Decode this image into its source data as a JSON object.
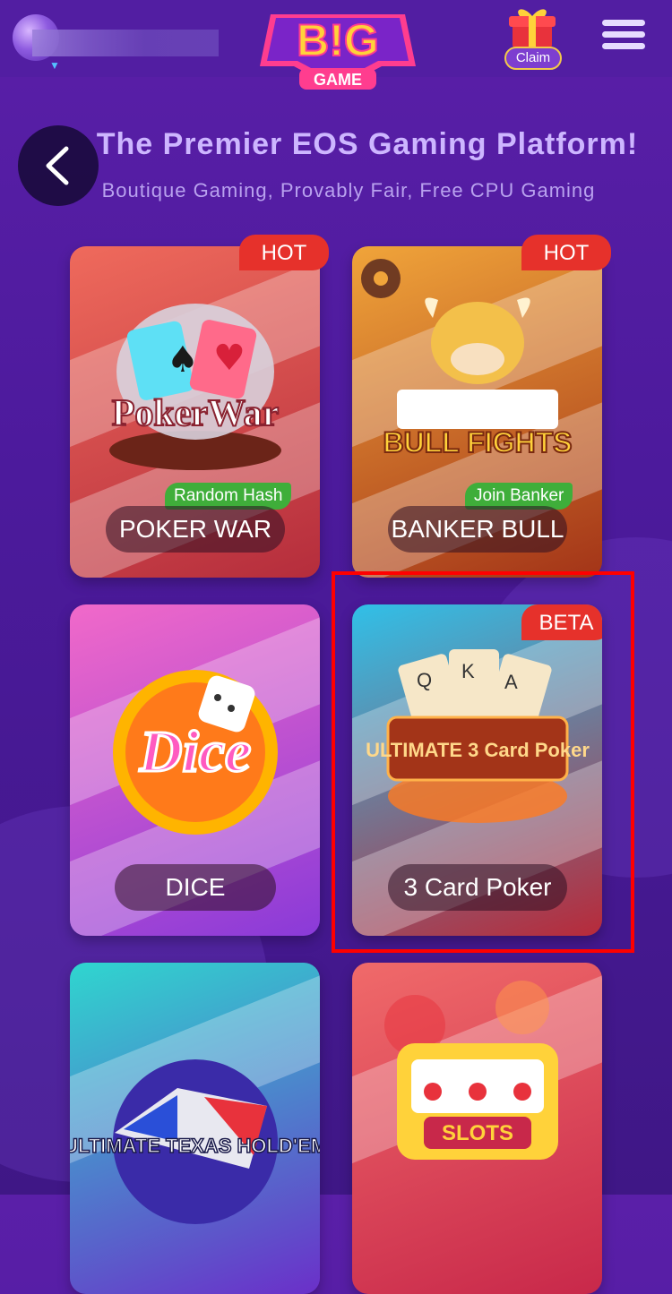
{
  "header": {
    "logo_top": "B!G",
    "logo_bottom": "GAME",
    "claim_label": "Claim"
  },
  "hero": {
    "title": "The Premier EOS Gaming Platform!",
    "subtitle": "Boutique Gaming, Provably Fair, Free CPU Gaming"
  },
  "games": [
    {
      "label": "POKER WAR",
      "badge": "HOT",
      "tag": "Random Hash",
      "art_text": "PokerWar",
      "colors": [
        "#ef6a5c",
        "#b52d3c"
      ]
    },
    {
      "label": "BANKER BULL",
      "badge": "HOT",
      "tag": "Join Banker",
      "art_text": "BULL FIGHTS",
      "colors": [
        "#f0a43a",
        "#a33418"
      ]
    },
    {
      "label": "DICE",
      "badge": "",
      "tag": "",
      "art_text": "Dice",
      "colors": [
        "#f169c9",
        "#8a3ad8"
      ]
    },
    {
      "label": "3 Card Poker",
      "badge": "BETA",
      "tag": "",
      "art_text": "ULTIMATE 3 Card Poker",
      "colors": [
        "#30c0e8",
        "#b82a3a"
      ]
    },
    {
      "label": "",
      "badge": "",
      "tag": "",
      "art_text": "ULTIMATE TEXAS HOLD'EM",
      "colors": [
        "#2fd6cf",
        "#6b2fc9"
      ]
    },
    {
      "label": "",
      "badge": "",
      "tag": "",
      "art_text": "SLOTS",
      "colors": [
        "#f06a6a",
        "#c8284a"
      ]
    }
  ]
}
